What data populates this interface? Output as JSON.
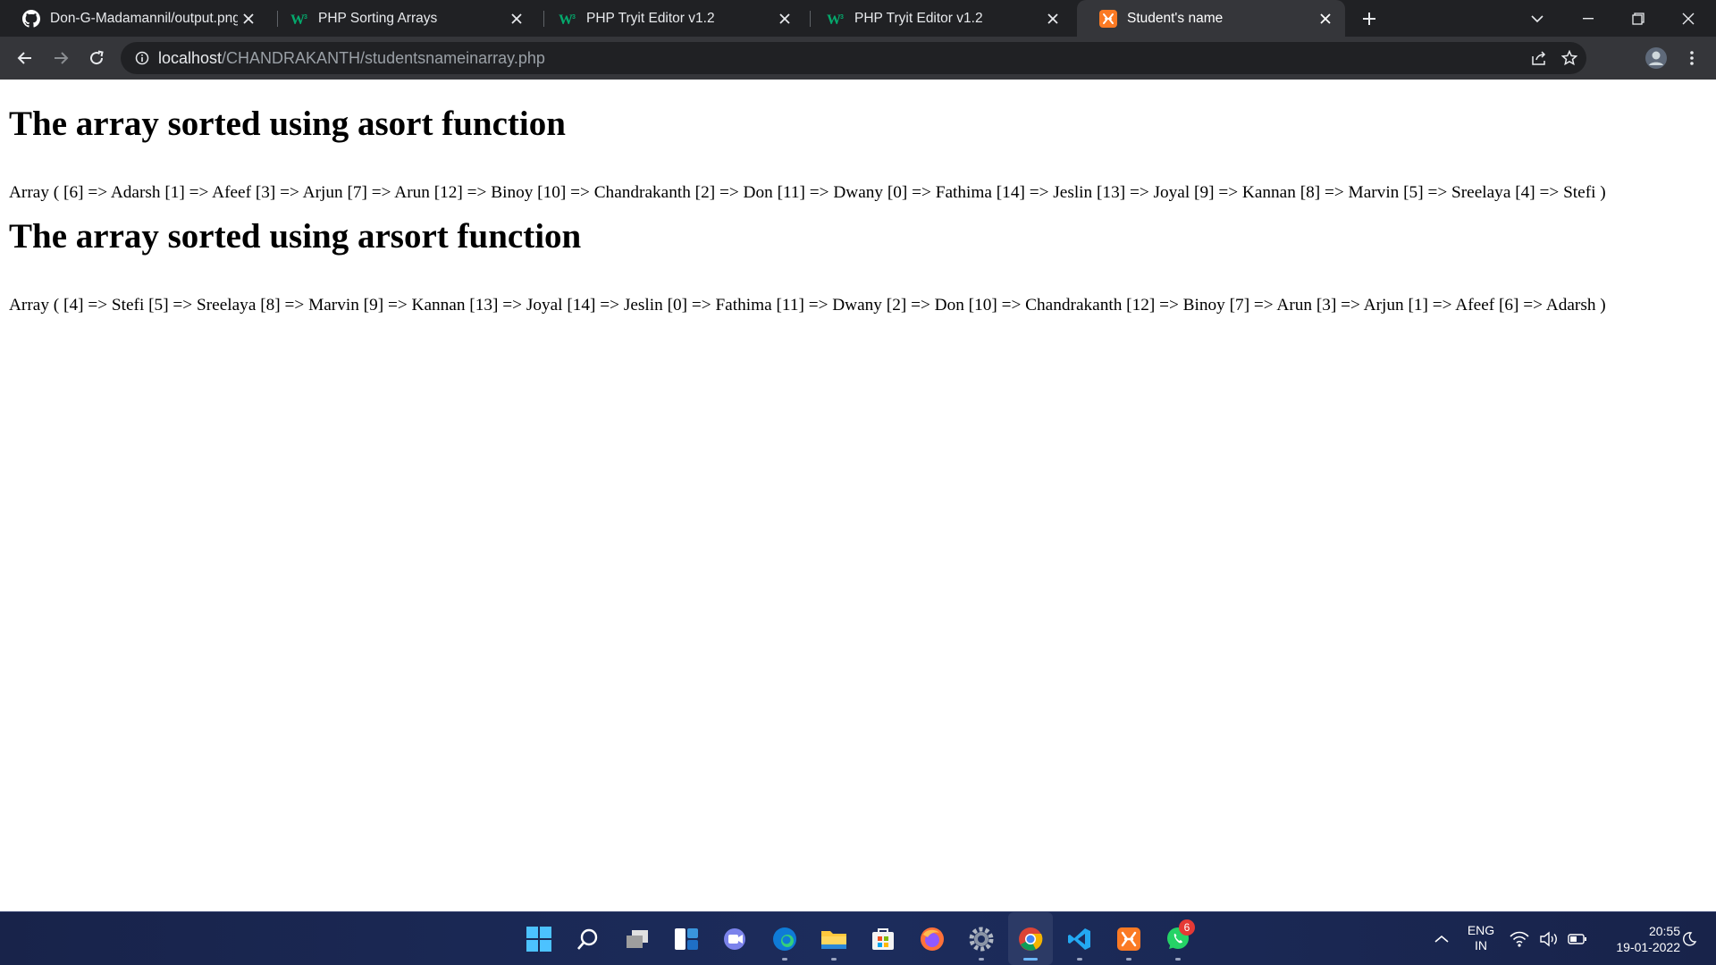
{
  "browser": {
    "tabs": [
      {
        "title": "Don-G-Madamannil/output.png",
        "favicon": "github-icon",
        "active": false
      },
      {
        "title": "PHP Sorting Arrays",
        "favicon": "w3schools-icon",
        "active": false
      },
      {
        "title": "PHP Tryit Editor v1.2",
        "favicon": "w3schools-icon",
        "active": false
      },
      {
        "title": "PHP Tryit Editor v1.2",
        "favicon": "w3schools-icon",
        "active": false
      },
      {
        "title": "Student's name",
        "favicon": "xampp-icon",
        "active": true
      }
    ],
    "url": {
      "host": "localhost",
      "path": "/CHANDRAKANTH/studentsnameinarray.php"
    },
    "colors": {
      "tabstrip": "#202124",
      "toolbar": "#35363a",
      "omnibox": "#202124",
      "w3_green": "#04aa6d",
      "xampp_orange": "#fb7a24"
    }
  },
  "page": {
    "heading_asort": "The array sorted using asort function",
    "output_asort": "Array ( [6] => Adarsh [1] => Afeef [3] => Arjun [7] => Arun [12] => Binoy [10] => Chandrakanth [2] => Don [11] => Dwany [0] => Fathima [14] => Jeslin [13] => Joyal [9] => Kannan [8] => Marvin [5] => Sreelaya [4] => Stefi )",
    "heading_arsort": "The array sorted using arsort function",
    "output_arsort": "Array ( [4] => Stefi [5] => Sreelaya [8] => Marvin [9] => Kannan [13] => Joyal [14] => Jeslin [0] => Fathima [11] => Dwany [2] => Don [10] => Chandrakanth [12] => Binoy [7] => Arun [3] => Arjun [1] => Afeef [6] => Adarsh )"
  },
  "taskbar": {
    "apps": [
      "start-icon",
      "search-icon",
      "task-view-icon",
      "widgets-icon",
      "teams-chat-icon",
      "edge-icon",
      "file-explorer-icon",
      "microsoft-store-icon",
      "firefox-icon",
      "settings-icon",
      "chrome-icon",
      "vscode-icon",
      "xampp-icon",
      "whatsapp-icon"
    ],
    "whatsapp_badge": "6",
    "language": {
      "line1": "ENG",
      "line2": "IN"
    },
    "clock": {
      "time": "20:55",
      "date": "19-01-2022"
    }
  }
}
